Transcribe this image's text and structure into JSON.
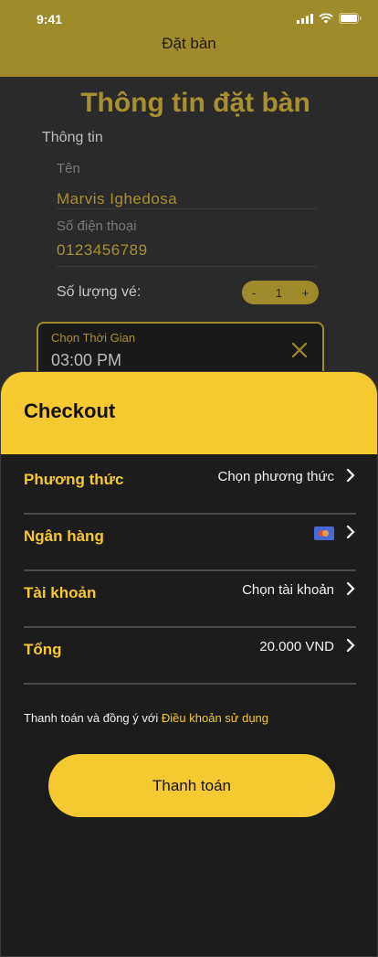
{
  "status_bar": {
    "time": "9:41"
  },
  "header": {
    "title": "Đặt bàn"
  },
  "form": {
    "title": "Thông tin đặt bàn",
    "section_label": "Thông tin",
    "name_label": "Tên",
    "name_value": "Marvis Ighedosa",
    "phone_label": "Số điện thoại",
    "phone_value": "0123456789",
    "quantity_label": "Số lượng vé:",
    "quantity": {
      "minus": "-",
      "value": "1",
      "plus": "+"
    },
    "time_picker": {
      "label": "Chọn Thời Gian",
      "value": "03:00 PM"
    }
  },
  "checkout": {
    "title": "Checkout",
    "rows": [
      {
        "label": "Phương thức",
        "value": "Chọn phương thức"
      },
      {
        "label": "Ngân hàng",
        "value": ""
      },
      {
        "label": "Tài khoản",
        "value": "Chọn tài khoản"
      },
      {
        "label": "Tổng",
        "value": "20.000 VND"
      }
    ],
    "terms_text": "Thanh toán và đồng ý với ",
    "terms_link": "Điều khoản sử dụng",
    "pay_button": "Thanh toán"
  },
  "colors": {
    "accent": "#f5c930",
    "header_dim": "#a08b2c",
    "sheet_bg": "#1c1c1c"
  }
}
